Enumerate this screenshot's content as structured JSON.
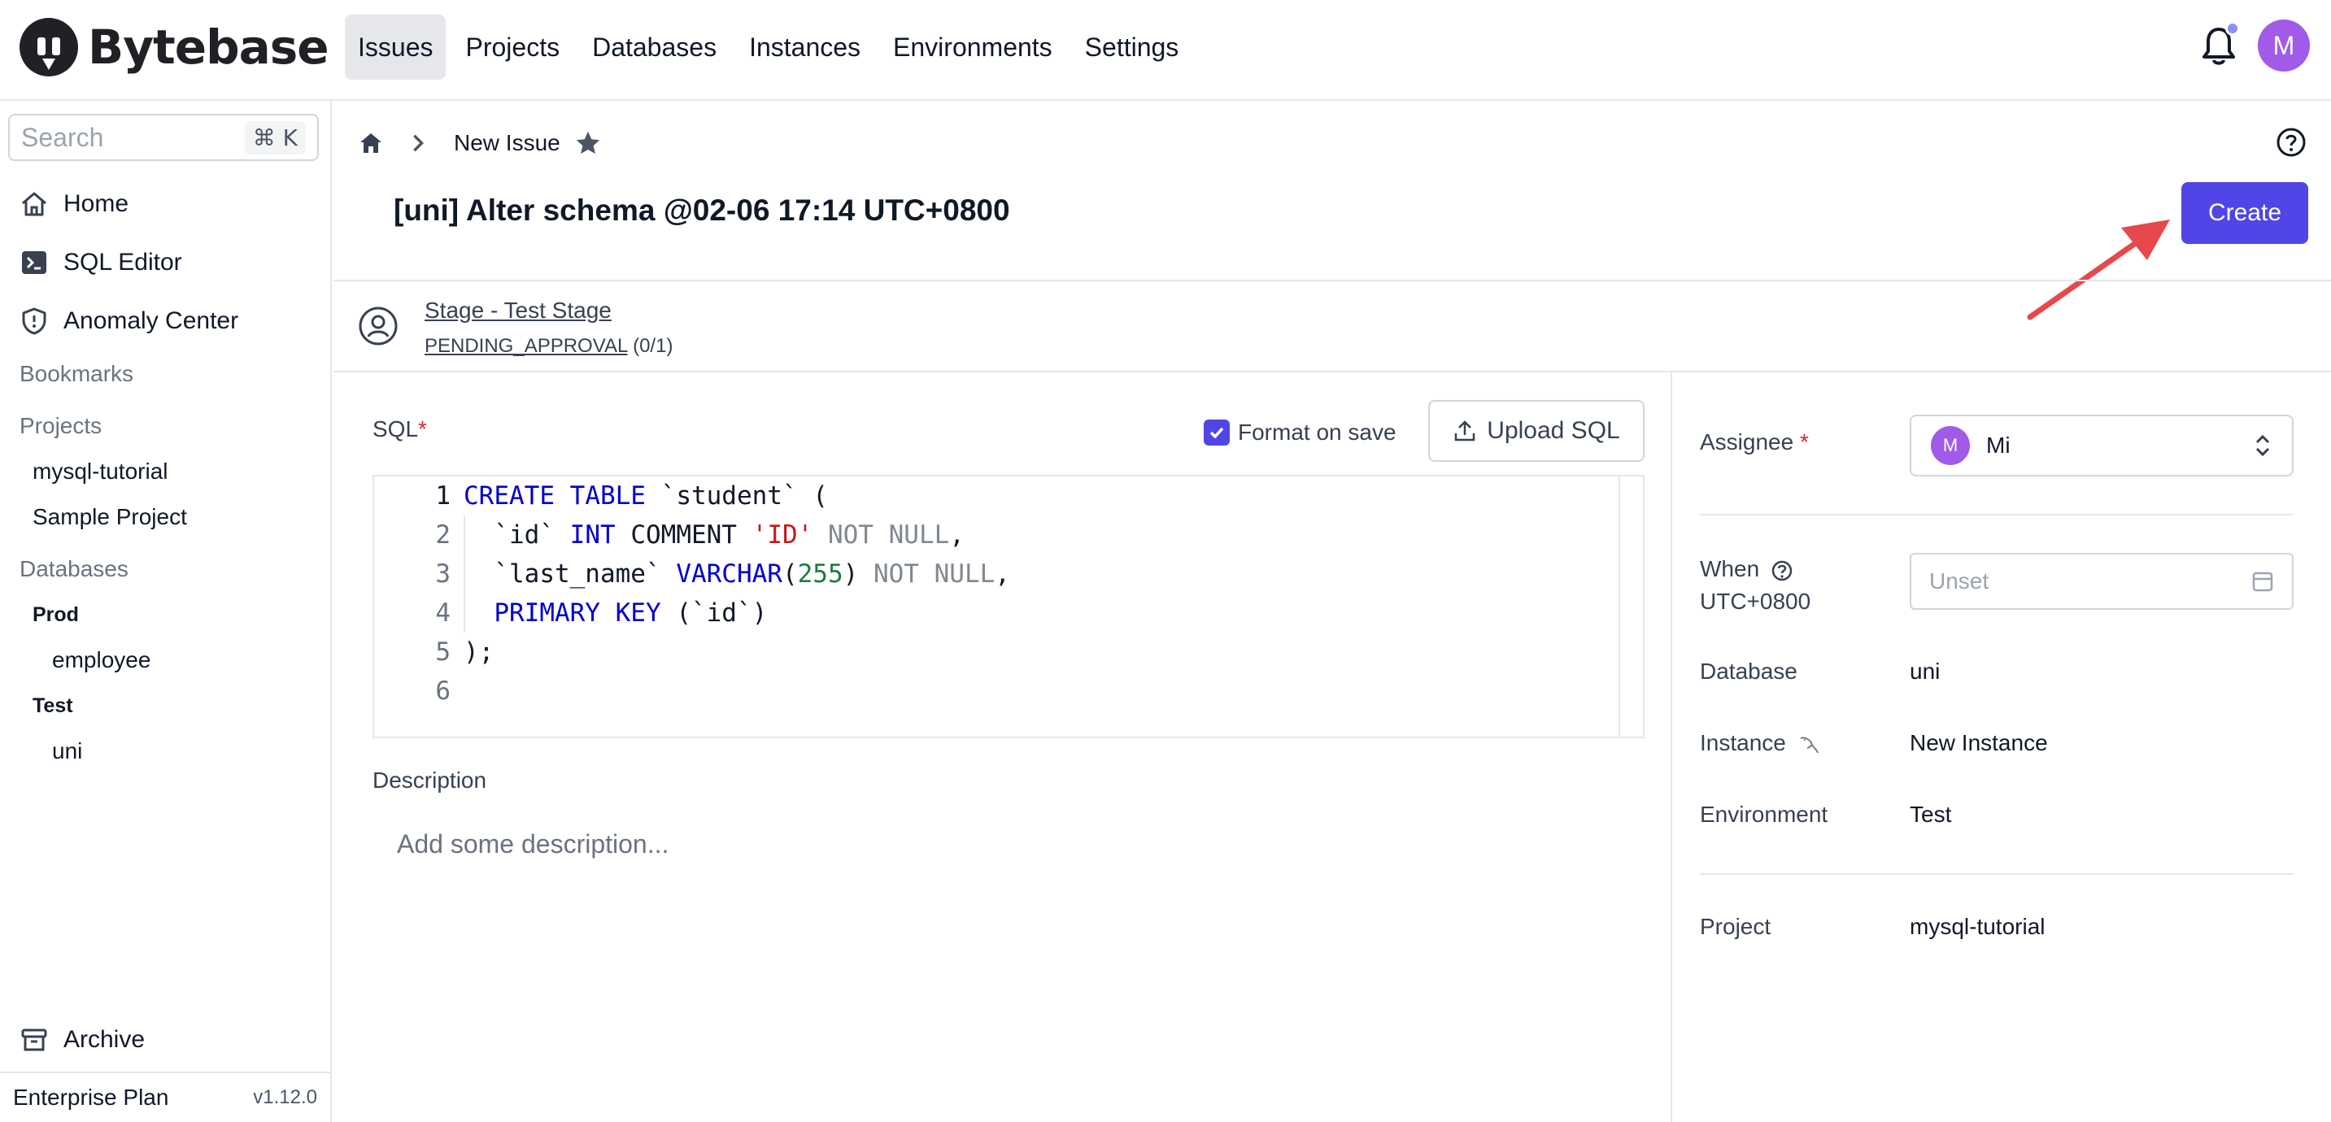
{
  "app": {
    "name": "Bytebase"
  },
  "nav": {
    "items": [
      {
        "label": "Issues",
        "active": true
      },
      {
        "label": "Projects"
      },
      {
        "label": "Databases"
      },
      {
        "label": "Instances"
      },
      {
        "label": "Environments"
      },
      {
        "label": "Settings"
      }
    ],
    "avatar_initial": "M"
  },
  "sidebar": {
    "search_placeholder": "Search",
    "search_shortcut": "⌘ K",
    "links": {
      "home": "Home",
      "sql_editor": "SQL Editor",
      "anomaly_center": "Anomaly Center"
    },
    "bookmarks_label": "Bookmarks",
    "projects_label": "Projects",
    "projects": [
      "mysql-tutorial",
      "Sample Project"
    ],
    "databases_label": "Databases",
    "environments": [
      {
        "name": "Prod",
        "databases": [
          "employee"
        ]
      },
      {
        "name": "Test",
        "databases": [
          "uni"
        ]
      }
    ],
    "archive_label": "Archive",
    "plan": "Enterprise Plan",
    "version": "v1.12.0"
  },
  "breadcrumb": {
    "current": "New Issue"
  },
  "issue": {
    "title": "[uni] Alter schema @02-06 17:14 UTC+0800",
    "create_label": "Create"
  },
  "stage": {
    "name": "Stage - Test Stage",
    "status": "PENDING_APPROVAL",
    "progress": "(0/1)"
  },
  "sql": {
    "label": "SQL",
    "required_mark": "*",
    "format_on_save": "Format on save",
    "format_checked": true,
    "upload_label": "Upload SQL",
    "line_numbers": [
      "1",
      "2",
      "3",
      "4",
      "5",
      "6"
    ]
  },
  "description": {
    "label": "Description",
    "placeholder": "Add some description..."
  },
  "details": {
    "assignee_label": "Assignee",
    "assignee_required": "*",
    "assignee_initial": "M",
    "assignee_name": "Mi",
    "when_label": "When",
    "timezone": "UTC+0800",
    "when_placeholder": "Unset",
    "database_label": "Database",
    "database_value": "uni",
    "instance_label": "Instance",
    "instance_value": "New Instance",
    "environment_label": "Environment",
    "environment_value": "Test",
    "project_label": "Project",
    "project_value": "mysql-tutorial"
  },
  "colors": {
    "primary": "#4f46e5",
    "avatar": "#a05be8",
    "annotation_arrow": "#e5484d"
  },
  "icons": [
    "logo-icon",
    "bell-icon",
    "home-icon",
    "sql-editor-icon",
    "shield-icon",
    "archive-icon",
    "chevron-right-icon",
    "star-icon",
    "help-icon",
    "user-circle-icon",
    "check-icon",
    "upload-icon",
    "updown-chevron-icon",
    "calendar-icon",
    "mysql-dolphin-icon"
  ]
}
